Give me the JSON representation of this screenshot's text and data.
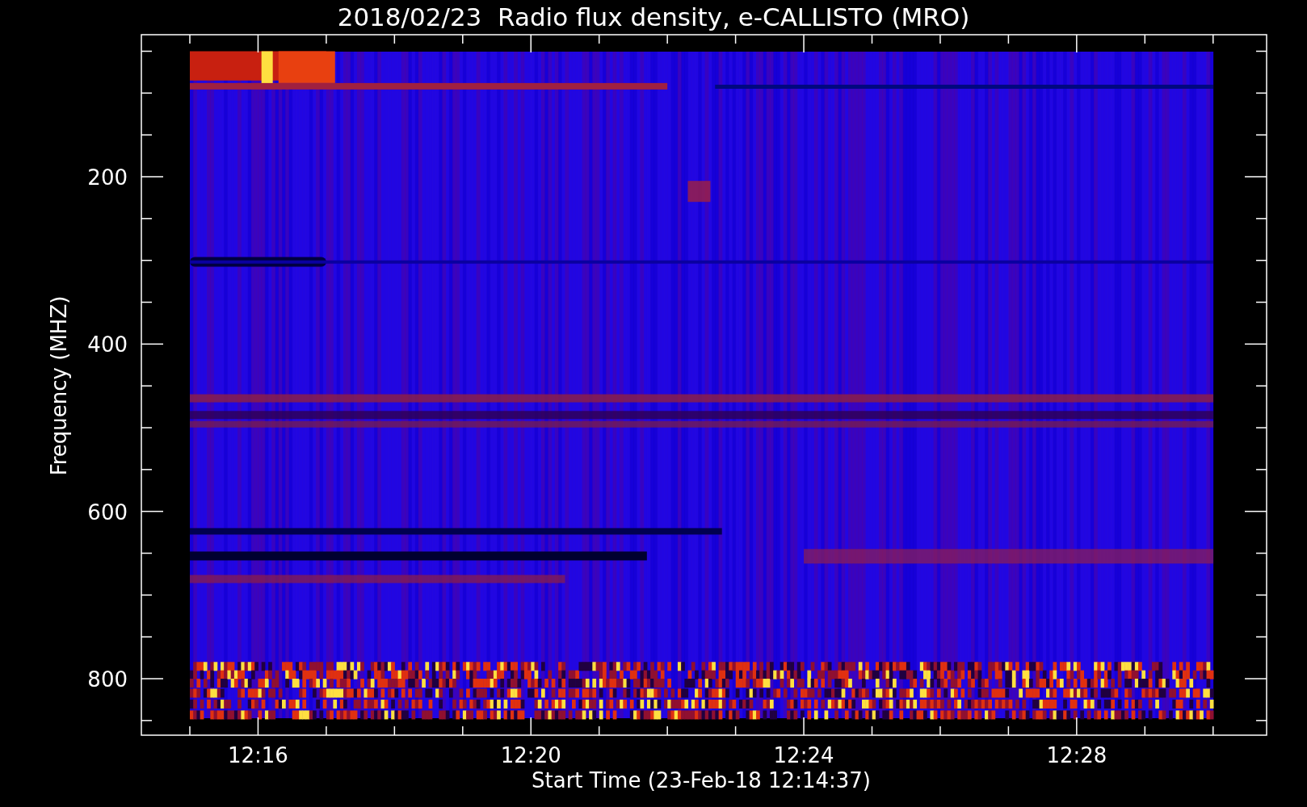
{
  "title": "2018/02/23  Radio flux density, e-CALLISTO (MRO)",
  "plot": {
    "ylabel": "Frequency (MHZ)",
    "xlabel": "Start Time (23-Feb-18 12:14:37)",
    "yticks": [
      "200",
      "400",
      "600",
      "800"
    ],
    "xticks": [
      "12:16",
      "12:20",
      "12:24",
      "12:28"
    ]
  }
}
